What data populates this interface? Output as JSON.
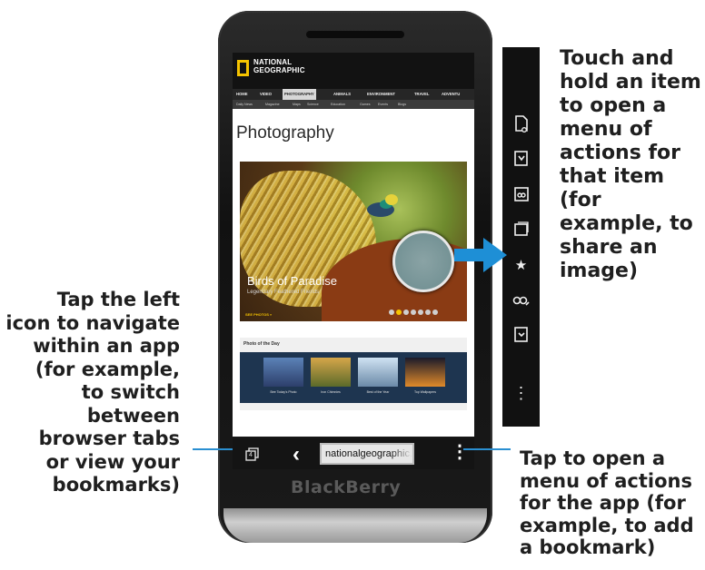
{
  "callouts": {
    "touch_hold": "Touch and\nhold an item\nto open a\nmenu of\nactions for\nthat item (for\nexample, to\nshare an\nimage)",
    "left_icon": "Tap the left\nicon to navigate\nwithin an app\n(for example,\nto switch\nbetween\nbrowser tabs\nor view your\nbookmarks)",
    "app_menu": "Tap to open a\nmenu of actions\nfor the app (for\nexample, to add\na bookmark)"
  },
  "website": {
    "logo_line1": "NATIONAL",
    "logo_line2": "GEOGRAPHIC",
    "nav": [
      "HOME",
      "VIDEO",
      "PHOTOGRAPHY",
      "ANIMALS",
      "ENVIRONMENT",
      "TRAVEL",
      "ADVENTU"
    ],
    "subnav": [
      "Daily News",
      "Magazine",
      "Maps",
      "Science",
      "Education",
      "Games",
      "Events",
      "Blogs"
    ],
    "page_title": "Photography",
    "hero_caption": "Birds of Paradise",
    "hero_subcaption": "Legendary Feathered Friends",
    "see_photos": "SEE PHOTOS »",
    "potd_title": "Photo of the Day",
    "thumbs": [
      "Bee Today's Photo",
      "Iron Chimnies",
      "Best of the Year",
      "Top Wallpapers"
    ]
  },
  "bottom_bar": {
    "tab_count": "4",
    "back_icon": "chevron-left-icon",
    "url": "nationalgeographic.com",
    "overflow_icon": "vertical-dots-icon"
  },
  "brand": "BlackBerry",
  "action_menu_icons": [
    "page-share-icon",
    "save-image-icon",
    "copy-link-icon",
    "copy-image-icon",
    "add-favorite-icon",
    "share-link-icon",
    "save-page-icon",
    "more-icon"
  ],
  "colors": {
    "accent_blue": "#1e8fd6",
    "natgeo_yellow": "#f6c400"
  }
}
